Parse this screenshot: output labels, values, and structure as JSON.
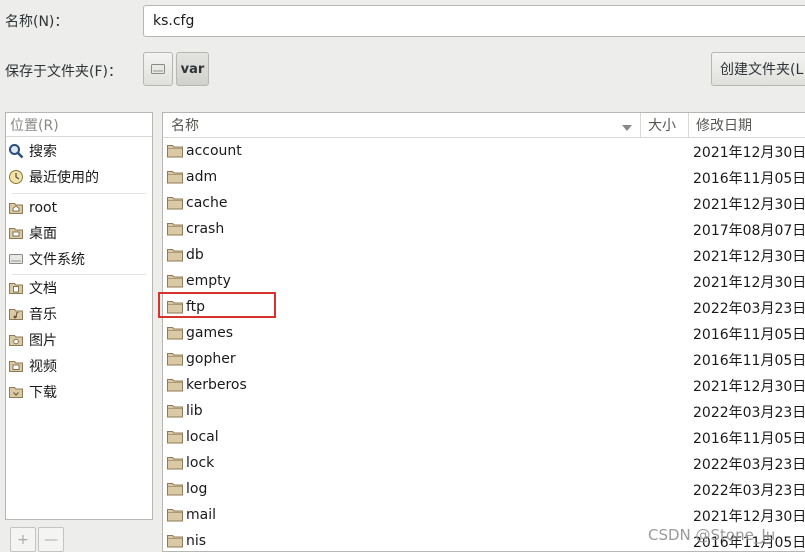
{
  "name_label": "名称(N)：",
  "name_value": "ks.cfg",
  "save_in_label": "保存于文件夹(F)：",
  "path_segment": "var",
  "create_folder_label": "创建文件夹(L",
  "places": {
    "header": "位置(R)",
    "items": [
      {
        "label": "搜索",
        "icon": "search-icon"
      },
      {
        "label": "最近使用的",
        "icon": "recent-icon"
      },
      {
        "label": "root",
        "icon": "home-folder-icon"
      },
      {
        "label": "桌面",
        "icon": "desktop-folder-icon"
      },
      {
        "label": "文件系统",
        "icon": "drive-icon"
      },
      {
        "label": "文档",
        "icon": "documents-folder-icon"
      },
      {
        "label": "音乐",
        "icon": "music-folder-icon"
      },
      {
        "label": "图片",
        "icon": "pictures-folder-icon"
      },
      {
        "label": "视频",
        "icon": "videos-folder-icon"
      },
      {
        "label": "下载",
        "icon": "downloads-folder-icon"
      }
    ],
    "add_label": "+",
    "remove_label": "—"
  },
  "columns": {
    "name": "名称",
    "size": "大小",
    "modified": "修改日期"
  },
  "files": [
    {
      "name": "account",
      "date": "2021年12月30日"
    },
    {
      "name": "adm",
      "date": "2016年11月05日"
    },
    {
      "name": "cache",
      "date": "2021年12月30日"
    },
    {
      "name": "crash",
      "date": "2017年08月07日"
    },
    {
      "name": "db",
      "date": "2021年12月30日"
    },
    {
      "name": "empty",
      "date": "2021年12月30日"
    },
    {
      "name": "ftp",
      "date": "2022年03月23日"
    },
    {
      "name": "games",
      "date": "2016年11月05日"
    },
    {
      "name": "gopher",
      "date": "2016年11月05日"
    },
    {
      "name": "kerberos",
      "date": "2021年12月30日"
    },
    {
      "name": "lib",
      "date": "2022年03月23日"
    },
    {
      "name": "local",
      "date": "2016年11月05日"
    },
    {
      "name": "lock",
      "date": "2022年03月23日"
    },
    {
      "name": "log",
      "date": "2022年03月23日"
    },
    {
      "name": "mail",
      "date": "2021年12月30日"
    },
    {
      "name": "nis",
      "date": "2016年11月05日"
    }
  ],
  "watermark": "CSDN @Stone_Ju",
  "colors": {
    "folder_fill": "#d9c9a5",
    "folder_stroke": "#8f7a55",
    "highlight": "#d7322d"
  }
}
